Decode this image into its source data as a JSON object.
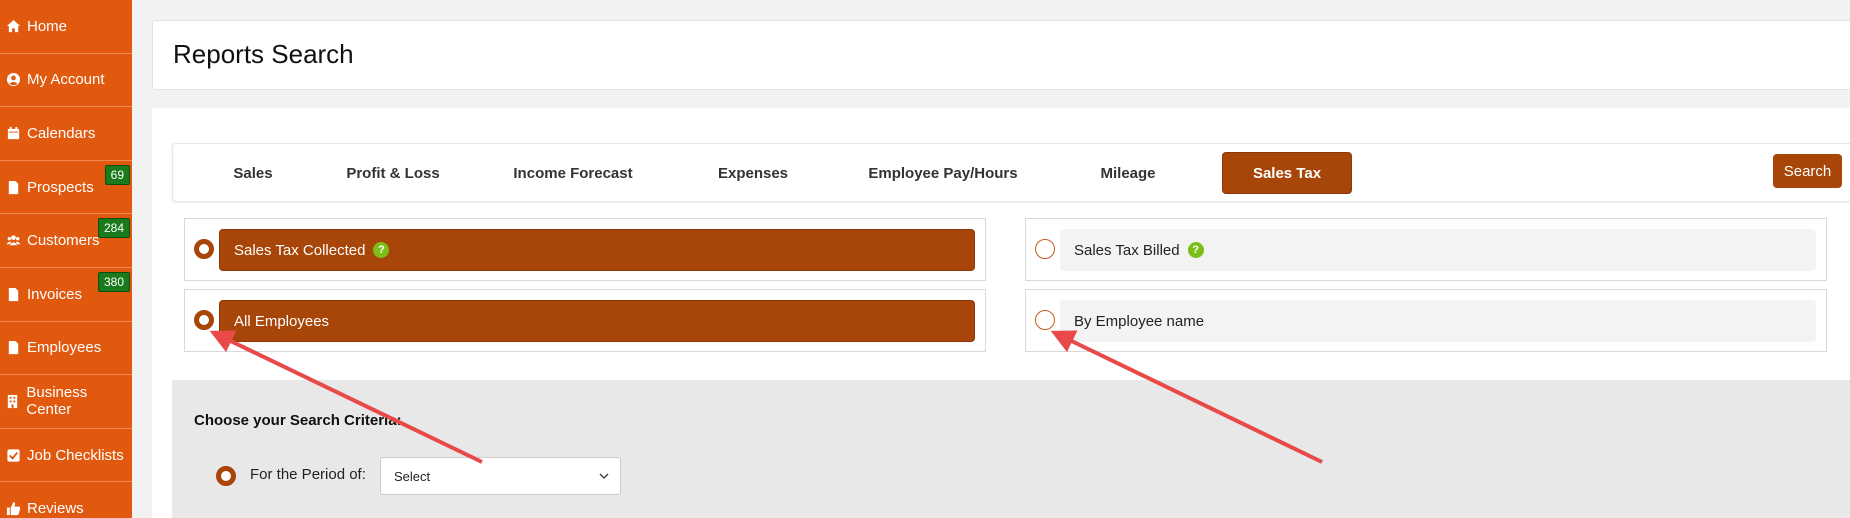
{
  "sidebar": {
    "items": [
      {
        "label": "Home",
        "icon": "home-icon"
      },
      {
        "label": "My Account",
        "icon": "user-circle-icon"
      },
      {
        "label": "Calendars",
        "icon": "calendar-icon"
      },
      {
        "label": "Prospects",
        "icon": "document-icon",
        "badge": "69"
      },
      {
        "label": "Customers",
        "icon": "users-icon",
        "badge": "284"
      },
      {
        "label": "Invoices",
        "icon": "document-icon",
        "badge": "380"
      },
      {
        "label": "Employees",
        "icon": "document-icon"
      },
      {
        "label": "Business Center",
        "icon": "building-icon"
      },
      {
        "label": "Job Checklists",
        "icon": "checkbox-icon"
      },
      {
        "label": "Reviews",
        "icon": "thumbs-up-icon"
      }
    ]
  },
  "header": {
    "title": "Reports Search"
  },
  "tabs": [
    {
      "label": "Sales"
    },
    {
      "label": "Profit & Loss"
    },
    {
      "label": "Income Forecast"
    },
    {
      "label": "Expenses"
    },
    {
      "label": "Employee Pay/Hours"
    },
    {
      "label": "Mileage"
    },
    {
      "label": "Sales Tax",
      "active": true
    }
  ],
  "search_button": "Search",
  "options": {
    "sales_tax_collected": "Sales Tax Collected",
    "sales_tax_billed": "Sales Tax Billed",
    "all_employees": "All Employees",
    "by_employee_name": "By Employee name",
    "help_glyph": "?"
  },
  "criteria": {
    "title": "Choose your Search Criteria:",
    "period_label": "For the Period of:",
    "period_value": "Select"
  },
  "colors": {
    "sidebar": "#e0590f",
    "accent": "#a84508",
    "badge": "#1b7a1b",
    "help": "#7cbf1a",
    "annotation_arrow": "#e84a4a"
  }
}
